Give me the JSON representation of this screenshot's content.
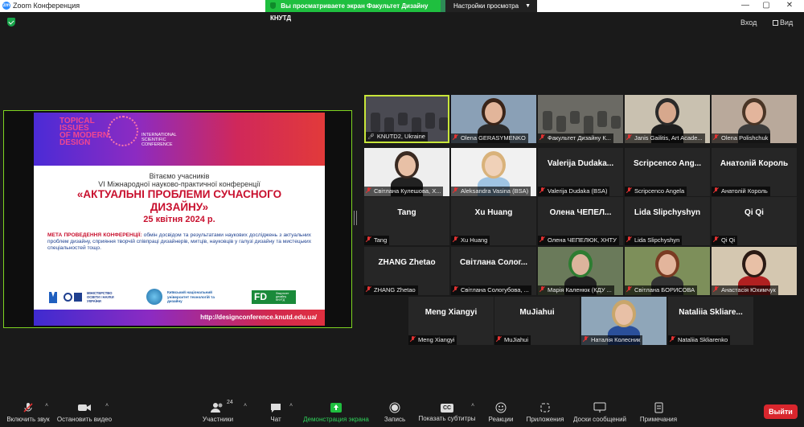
{
  "app": {
    "title": "Zoom Конференция",
    "icon": "zoom-logo",
    "window_controls": [
      "—",
      "▢",
      "✕"
    ]
  },
  "share_banner": {
    "message": "Вы просматриваете экран Факультет Дизайну КНУТД",
    "options_label": "Настройки просмотра"
  },
  "top_right": {
    "exit_label": "Вход",
    "view_label": "Вид"
  },
  "shared_screen": {
    "slide": {
      "logo_text": "TOPICAL ISSUES OF MODERN DESIGN",
      "conference_tag": "INTERNATIONAL SCIENTIFIC CONFERENCE",
      "welcome": "Вітаємо учасників",
      "conference_line": "VI Міжнародної науково-практичної конференції",
      "title_line1": "«АКТУАЛЬНІ ПРОБЛЕМИ СУЧАСНОГО",
      "title_line2": "ДИЗАЙНУ»",
      "date": "25 квітня 2024 р.",
      "goal_label": "МЕТА ПРОВЕДЕННЯ КОНФЕРЕНЦІЇ:",
      "goal_text": "обмін досвідом та результатами наукових досліджень з актуальних проблем дизайну, сприяння творчій співпраці дизайнерів, митців, науковців у галузі дизайну та мистецьких спеціальностей тощо.",
      "ministry_text": "МІНІСТЕРСТВО ОСВІТИ І НАУКИ УКРАЇНИ",
      "university_text": "Київський національний університет технологій та дизайну",
      "fd_logo": "FD",
      "fd_text": "Факультет дизайну КНУТД",
      "url": "http://designconference.knutd.edu.ua/"
    }
  },
  "participants": [
    {
      "label": "KNUTD2, Ukraine",
      "muted": false,
      "video": true,
      "active": true
    },
    {
      "label": "Olena GERASYMENKO",
      "muted": true,
      "video": true
    },
    {
      "label": "Факультет Дизайну К...",
      "muted": true,
      "video": true
    },
    {
      "label": "Janis Gailitis, Art Acade...",
      "muted": true,
      "video": true
    },
    {
      "label": "Olena Polishchuk",
      "muted": true,
      "video": true
    },
    {
      "label": "Світлана Кулешова, Х...",
      "muted": true,
      "video": true
    },
    {
      "label": "Aleksandra Vasina (BSA)",
      "muted": true,
      "video": true
    },
    {
      "label": "Valerija Dudaka (BSA)",
      "display": "Valerija Dudaka...",
      "muted": true,
      "video": false
    },
    {
      "label": "Scripcenco Angela",
      "display": "Scripcenco Ang...",
      "muted": true,
      "video": false
    },
    {
      "label": "Анатолій Король",
      "display": "Анатолій Король",
      "muted": true,
      "video": false
    },
    {
      "label": "Tang",
      "display": "Tang",
      "muted": true,
      "video": false
    },
    {
      "label": "Xu Huang",
      "display": "Xu Huang",
      "muted": true,
      "video": false
    },
    {
      "label": "Олена ЧЕПЕЛЮК, ХНТУ",
      "display": "Олена ЧЕПЕЛ...",
      "muted": true,
      "video": false
    },
    {
      "label": "Lida Slipchyshyn",
      "display": "Lida Slipchyshyn",
      "muted": true,
      "video": false
    },
    {
      "label": "Qi Qi",
      "display": "Qi Qi",
      "muted": true,
      "video": false
    },
    {
      "label": "ZHANG Zhetao",
      "display": "ZHANG Zhetao",
      "muted": true,
      "video": false
    },
    {
      "label": "Світлана Сологубова, ...",
      "display": "Світлана Солог...",
      "muted": true,
      "video": false
    },
    {
      "label": "Марія Каленюк (КДУ ...",
      "muted": true,
      "video": true
    },
    {
      "label": "Світлана БОРИСОВА",
      "muted": true,
      "video": true
    },
    {
      "label": "Анастасія Юхимчук",
      "muted": true,
      "video": true
    },
    {
      "label": "Meng Xiangyi",
      "display": "Meng Xiangyi",
      "muted": true,
      "video": false
    },
    {
      "label": "MuJiahui",
      "display": "MuJiahui",
      "muted": true,
      "video": false
    },
    {
      "label": "Наталія Колесник",
      "muted": true,
      "video": true
    },
    {
      "label": "Nataliia Skliarenko",
      "display": "Nataliia Skliare...",
      "muted": true,
      "video": false
    }
  ],
  "toolbar": {
    "unmute_label": "Включить звук",
    "start_video_label": "Остановить видео",
    "participants_label": "Участники",
    "participants_count": "24",
    "chat_label": "Чат",
    "share_label": "Демонстрация экрана",
    "record_label": "Запись",
    "captions_label": "Показать субтитры",
    "captions_icon_text": "CC",
    "reactions_label": "Реакции",
    "apps_label": "Приложения",
    "whiteboards_label": "Доски сообщений",
    "notes_label": "Примечания",
    "leave_label": "Выйти"
  },
  "colors": {
    "accent_green": "#1fbf3f",
    "active_border": "#c8e63a",
    "leave_red": "#d9262d",
    "muted_red": "#e03232"
  }
}
